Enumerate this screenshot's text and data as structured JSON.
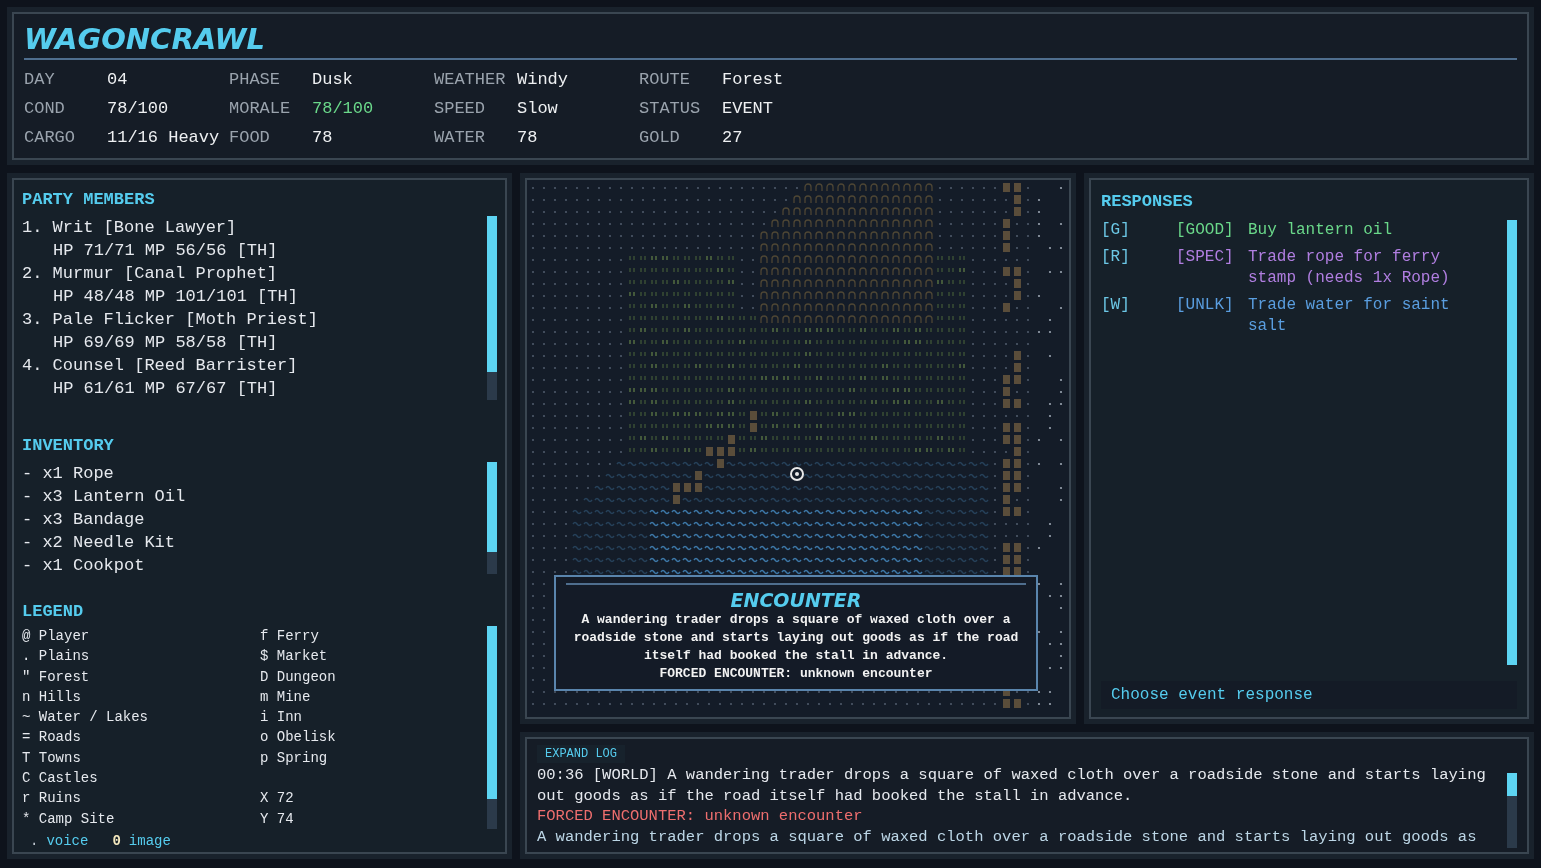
{
  "header": {
    "title": "WAGONCRAWL",
    "stats": [
      {
        "label": "DAY",
        "value": "04"
      },
      {
        "label": "PHASE",
        "value": "Dusk"
      },
      {
        "label": "WEATHER",
        "value": "Windy"
      },
      {
        "label": "ROUTE",
        "value": "Forest"
      },
      {
        "label": "COND",
        "value": "78/100"
      },
      {
        "label": "MORALE",
        "value": "78/100",
        "color": "#6ad88a"
      },
      {
        "label": "SPEED",
        "value": "Slow"
      },
      {
        "label": "STATUS",
        "value": "EVENT"
      },
      {
        "label": "CARGO",
        "value": "11/16 Heavy"
      },
      {
        "label": "FOOD",
        "value": "78"
      },
      {
        "label": "WATER",
        "value": "78"
      },
      {
        "label": "GOLD",
        "value": "27"
      }
    ]
  },
  "party": {
    "title": "PARTY MEMBERS",
    "members": [
      {
        "name": "1. Writ [Bone Lawyer]",
        "stats": "HP 71/71 MP 56/56 [TH]"
      },
      {
        "name": "2. Murmur [Canal Prophet]",
        "stats": "HP 48/48 MP 101/101 [TH]"
      },
      {
        "name": "3. Pale Flicker [Moth Priest]",
        "stats": "HP 69/69 MP 58/58 [TH]"
      },
      {
        "name": "4. Counsel [Reed Barrister]",
        "stats": "HP 61/61 MP 67/67 [TH]"
      }
    ]
  },
  "inventory": {
    "title": "INVENTORY",
    "items": [
      "- x1 Rope",
      "- x3 Lantern Oil",
      "- x3 Bandage",
      "- x2 Needle Kit",
      "- x1 Cookpot"
    ]
  },
  "legend": {
    "title": "LEGEND",
    "rows": [
      {
        "left": "@ Player",
        "right": "f Ferry"
      },
      {
        "left": ". Plains",
        "right": "$ Market"
      },
      {
        "left": "\" Forest",
        "right": "D Dungeon"
      },
      {
        "left": "n Hills",
        "right": "m Mine"
      },
      {
        "left": "~ Water / Lakes",
        "right": "i Inn"
      },
      {
        "left": "= Roads",
        "right": "o Obelisk"
      },
      {
        "left": "T Towns",
        "right": "p Spring"
      },
      {
        "left": "C Castles"
      },
      {
        "left": "r Ruins",
        "right": "X 72"
      },
      {
        "left": "* Camp Site",
        "right": "Y 74"
      }
    ],
    "footer": [
      {
        "key": ".",
        "label": "voice"
      },
      {
        "key": "0",
        "label": "image"
      }
    ]
  },
  "encounter": {
    "title": "ENCOUNTER",
    "text": "A wandering trader drops a square of waxed cloth over a roadside stone and starts laying out goods as if the road itself had booked the stall in advance.",
    "note": "FORCED ENCOUNTER: unknown encounter"
  },
  "responses": {
    "title": "RESPONSES",
    "items": [
      {
        "key": "[G]",
        "tag": "[GOOD]",
        "text": "Buy lantern oil",
        "kind": "good"
      },
      {
        "key": "[R]",
        "tag": "[SPEC]",
        "text": "Trade rope for ferry stamp (needs 1x Rope)",
        "kind": "spec"
      },
      {
        "key": "[W]",
        "tag": "[UNLK]",
        "text": "Trade water for saint salt",
        "kind": "unlk"
      }
    ],
    "prompt": {
      "placeholder": "Choose event response"
    }
  },
  "log": {
    "button": "EXPAND LOG",
    "lines": [
      {
        "kind": "world",
        "text": "00:36 [WORLD] A wandering trader drops a square of waxed cloth over a roadside stone and starts laying out goods as if the road itself had booked the stall in advance."
      },
      {
        "kind": "forced",
        "text": "FORCED ENCOUNTER: unknown encounter"
      },
      {
        "kind": "plain",
        "text": "A wandering trader drops a square of waxed cloth over a roadside stone and starts laying out goods as"
      }
    ]
  }
}
